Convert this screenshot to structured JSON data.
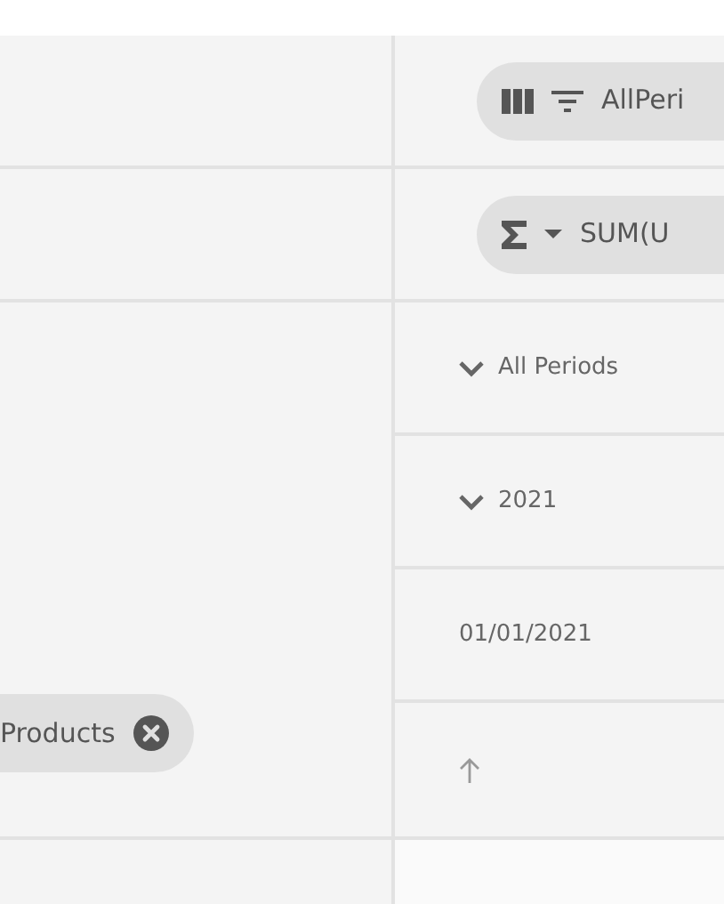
{
  "column_chip": {
    "label": "AllPeri"
  },
  "value_chip": {
    "label": "SUM(U"
  },
  "row_chip": {
    "label": "Products"
  },
  "period_rows": [
    {
      "kind": "group",
      "label": "All Periods",
      "expanded": true
    },
    {
      "kind": "group",
      "label": "2021",
      "expanded": true
    },
    {
      "kind": "date",
      "label": "01/01/2021"
    },
    {
      "kind": "sort"
    }
  ]
}
